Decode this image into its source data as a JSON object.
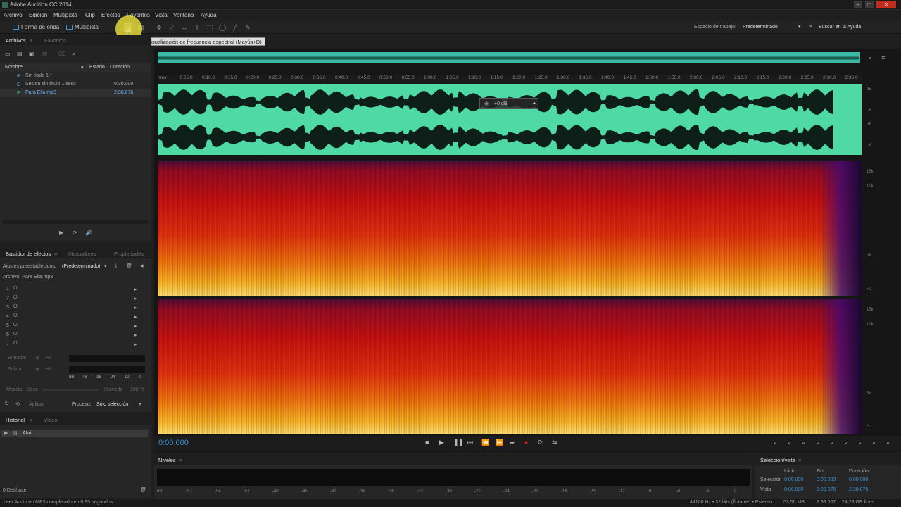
{
  "window": {
    "title": "Adobe Audition CC 2014"
  },
  "menu": [
    "Archivo",
    "Edición",
    "Multipista",
    "Clip",
    "Efectos",
    "Favoritos",
    "Vista",
    "Ventana",
    "Ayuda"
  ],
  "toolbar": {
    "waveform_label": "Forma de onda",
    "multitrack_label": "Multipista",
    "tooltip": "...trar visualización de frecuencia espectral (Mayús+D)",
    "workspace_label": "Espacio de trabajo:",
    "workspace_value": "Predeterminado",
    "help_search": "Buscar en la Ayuda"
  },
  "files_panel": {
    "tabs": [
      "Archivos",
      "Favoritos"
    ],
    "columns": [
      "Nombre",
      "Estado",
      "Duración"
    ],
    "items": [
      {
        "name": "Sin título 1 *",
        "duration": ""
      },
      {
        "name": "Sesión sin título 1.sesx",
        "duration": "0:30.000"
      },
      {
        "name": "Para Ella.mp3",
        "duration": "2:38.876"
      }
    ]
  },
  "effects_panel": {
    "tabs": [
      "Bastidor de efectos",
      "Marcadores",
      "Propiedades"
    ],
    "presets_label": "Ajustes preestablecidos:",
    "presets_value": "(Predeterminado)",
    "file_label": "Archivo: Para Ella.mp3",
    "slots": [
      "1",
      "2",
      "3",
      "4",
      "5",
      "6",
      "7"
    ],
    "input_label": "Entrada:",
    "output_label": "Salida:",
    "gain_value": "+0",
    "mix_label": "Mezcla:",
    "dry_label": "Seco",
    "wet_label": "Húmedo",
    "wet_value": "100 %",
    "apply_label": "Aplicar",
    "process_label": "Proceso:",
    "process_value": "Sólo selección",
    "meter_ticks": [
      "dB",
      "-48",
      "-36",
      "-24",
      "-12",
      "0"
    ]
  },
  "history_panel": {
    "tabs": [
      "Historial",
      "Vídeo"
    ],
    "items": [
      "Abrir"
    ],
    "undo_count": "0 Deshacer"
  },
  "ruler": {
    "labels": [
      "hms",
      "0:05.0",
      "0:10.0",
      "0:15.0",
      "0:20.0",
      "0:25.0",
      "0:30.0",
      "0:35.0",
      "0:40.0",
      "0:45.0",
      "0:50.0",
      "0:55.0",
      "1:00.0",
      "1:05.0",
      "1:10.0",
      "1:15.0",
      "1:20.0",
      "1:25.0",
      "1:30.0",
      "1:35.0",
      "1:40.0",
      "1:45.0",
      "1:50.0",
      "1:55.0",
      "2:00.0",
      "2:05.0",
      "2:10.0",
      "2:15.0",
      "2:20.0",
      "2:25.0",
      "2:30.0",
      "2:35.0"
    ]
  },
  "hud": {
    "value": "+0 dB"
  },
  "amplitude_scale": [
    "dB",
    "-6",
    "dB",
    "-6"
  ],
  "frequency_scale": [
    "15k",
    "10k",
    "5k",
    "Hz"
  ],
  "transport": {
    "timecode": "0:00.000"
  },
  "levels_panel": {
    "title": "Niveles",
    "ticks": [
      "dB",
      "-57",
      "-54",
      "-51",
      "-48",
      "-45",
      "-42",
      "-39",
      "-36",
      "-33",
      "-30",
      "-27",
      "-24",
      "-21",
      "-18",
      "-15",
      "-12",
      "-9",
      "-6",
      "-3",
      "0"
    ]
  },
  "selection_panel": {
    "title": "Selección/vista",
    "col_start": "Inicio",
    "col_end": "Fin",
    "col_duration": "Duración",
    "row_selection": "Selección",
    "row_view": "Vista",
    "sel_start": "0:00.000",
    "sel_end": "0:00.000",
    "sel_duration": "0:00.000",
    "view_start": "0:00.000",
    "view_end": "2:38.876",
    "view_duration": "2:38.876"
  },
  "status": {
    "message": "Leer Audio en MP3 completado en 0,95 segundos",
    "format": "44100 Hz • 32 bits (flotante) • Estéreo",
    "size": "53,50 MB",
    "duration": "2:39.007",
    "free": "24,28 GB libre"
  },
  "colors": {
    "waveform_bg": "#4ed9a5",
    "accent_blue": "#3a8fd9",
    "record_red": "#d02020"
  }
}
